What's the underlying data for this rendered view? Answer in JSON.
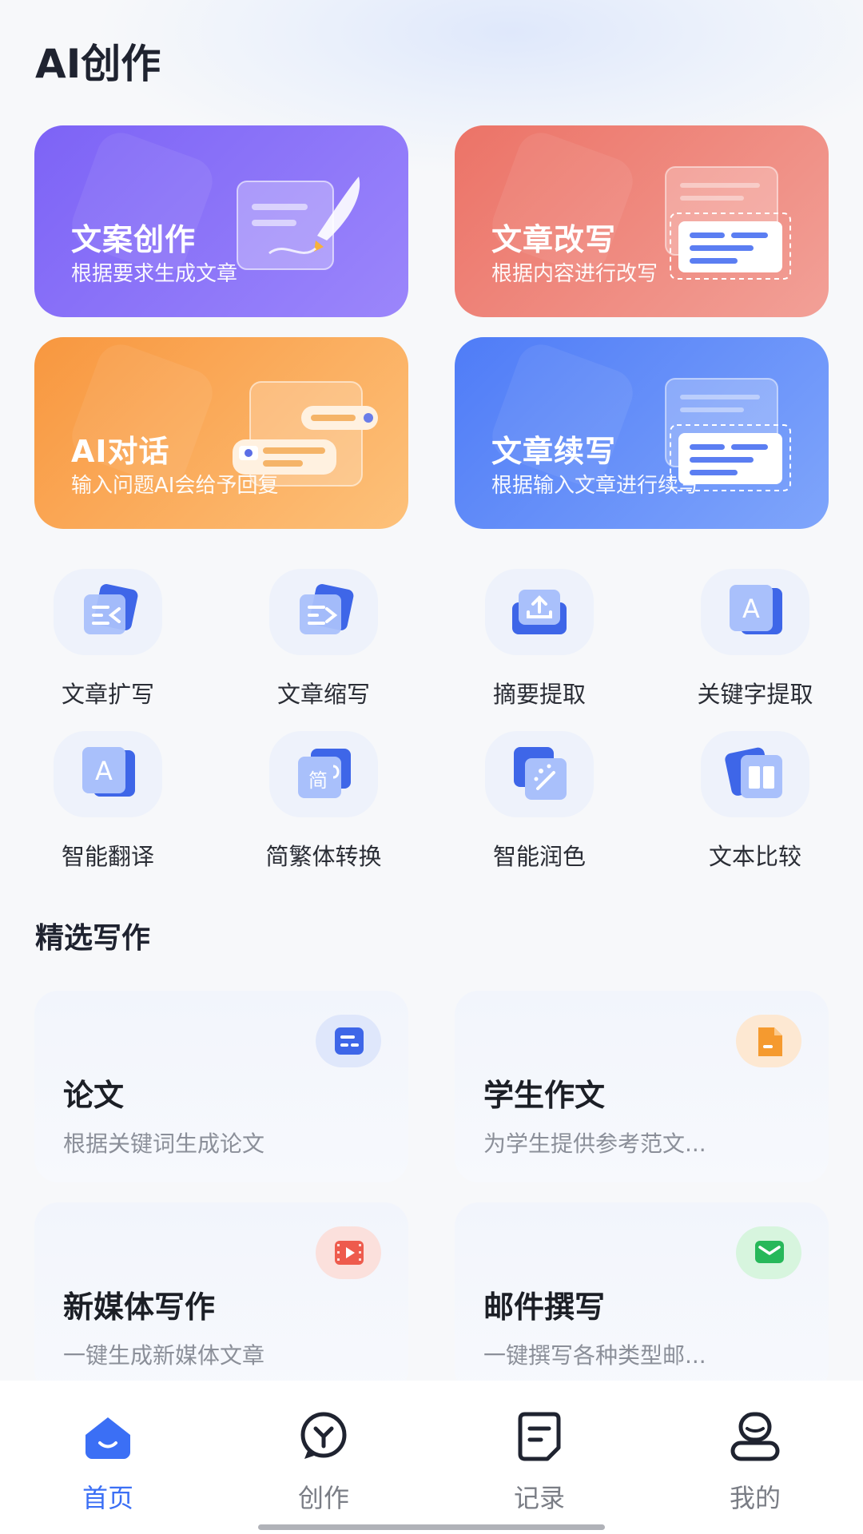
{
  "header": {
    "title": "AI创作"
  },
  "feature_cards": [
    {
      "title": "文案创作",
      "subtitle": "根据要求生成文章",
      "icon": "pen-document-icon"
    },
    {
      "title": "文章改写",
      "subtitle": "根据内容进行改写",
      "icon": "rewrite-document-icon"
    },
    {
      "title": "AI对话",
      "subtitle": "输入问题AI会给予回复",
      "icon": "chat-bubbles-icon"
    },
    {
      "title": "文章续写",
      "subtitle": "根据输入文章进行续写",
      "icon": "continue-document-icon"
    }
  ],
  "tools": [
    {
      "label": "文章扩写",
      "icon": "expand-text-icon"
    },
    {
      "label": "文章缩写",
      "icon": "shorten-text-icon"
    },
    {
      "label": "摘要提取",
      "icon": "upload-tray-icon"
    },
    {
      "label": "关键字提取",
      "icon": "letter-a-icon"
    },
    {
      "label": "智能翻译",
      "icon": "translate-icon"
    },
    {
      "label": "简繁体转换",
      "icon": "simplified-traditional-icon"
    },
    {
      "label": "智能润色",
      "icon": "magic-wand-icon"
    },
    {
      "label": "文本比较",
      "icon": "book-compare-icon"
    }
  ],
  "featured_section": {
    "title": "精选写作"
  },
  "writing_cards": [
    {
      "title": "论文",
      "subtitle": "根据关键词生成论文",
      "icon": "paper-icon",
      "accent": "#3e66e8"
    },
    {
      "title": "学生作文",
      "subtitle": "为学生提供参考范文...",
      "icon": "essay-file-icon",
      "accent": "#f59a2f"
    },
    {
      "title": "新媒体写作",
      "subtitle": "一键生成新媒体文章",
      "icon": "video-icon",
      "accent": "#ee5b4d"
    },
    {
      "title": "邮件撰写",
      "subtitle": "一键撰写各种类型邮...",
      "icon": "mail-icon",
      "accent": "#27b85a"
    }
  ],
  "bottom_nav": [
    {
      "label": "首页",
      "icon": "home-icon",
      "active": true
    },
    {
      "label": "创作",
      "icon": "create-icon",
      "active": false
    },
    {
      "label": "记录",
      "icon": "record-icon",
      "active": false
    },
    {
      "label": "我的",
      "icon": "profile-icon",
      "active": false
    }
  ],
  "colors": {
    "accent": "#3b6ff5",
    "nav_inactive": "#7a7d85"
  }
}
